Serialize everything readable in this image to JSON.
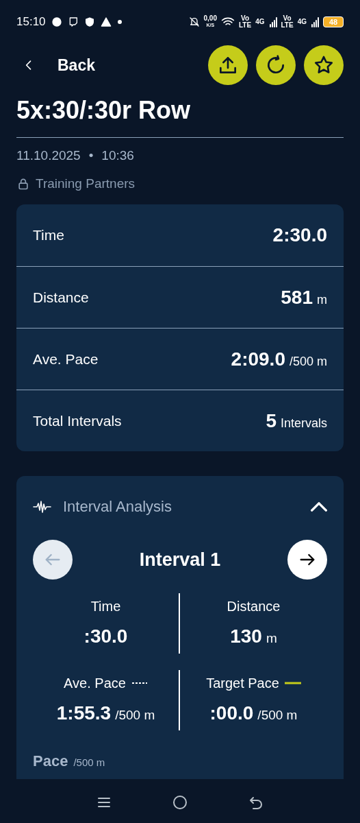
{
  "status_bar": {
    "time": "15:10",
    "speed": "0,00",
    "speed_unit": "K/S",
    "sim1": [
      "Vo",
      "LTE"
    ],
    "net1": "4G",
    "sim2": [
      "Vo",
      "LTE"
    ],
    "net2": "4G",
    "battery": "48"
  },
  "header": {
    "back": "Back"
  },
  "title": "5x:30/:30r Row",
  "date": "11.10.2025",
  "separator": "•",
  "time": "10:36",
  "visibility": "Training Partners",
  "summary": [
    {
      "label": "Time",
      "value": "2:30.0"
    },
    {
      "label": "Distance",
      "value": "581",
      "unit": "m"
    },
    {
      "label": "Ave. Pace",
      "value": "2:09.0",
      "unit": "/500 m"
    },
    {
      "label": "Total Intervals",
      "value": "5",
      "unit": "Intervals"
    }
  ],
  "analysis": {
    "title": "Interval Analysis",
    "expanded": true,
    "prev_disabled": true,
    "next_disabled": false,
    "interval": "Interval 1",
    "metrics": [
      {
        "label": "Time",
        "value": ":30.0"
      },
      {
        "label": "Distance",
        "value": "130",
        "unit": "m"
      },
      {
        "label": "Ave. Pace",
        "value": "1:55.3",
        "unit": "/500 m",
        "kind": "dashed"
      },
      {
        "label": "Target Pace",
        "value": ":00.0",
        "unit": "/500 m",
        "kind": "solid",
        "color": "#c5cc1a"
      }
    ],
    "chart_title": "Pace",
    "chart_unit": "/500 m"
  }
}
